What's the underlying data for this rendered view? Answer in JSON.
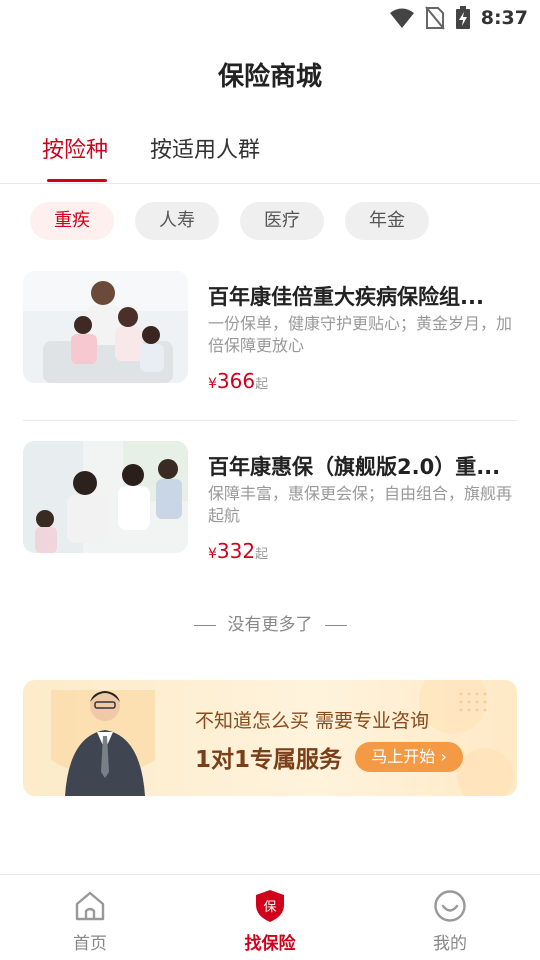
{
  "status_bar": {
    "time": "8:37"
  },
  "header": {
    "title": "保险商城"
  },
  "tabs": [
    {
      "label": "按险种"
    },
    {
      "label": "按适用人群"
    }
  ],
  "chips": [
    {
      "label": "重疾"
    },
    {
      "label": "人寿"
    },
    {
      "label": "医疗"
    },
    {
      "label": "年金"
    }
  ],
  "products": [
    {
      "title": "百年康佳倍重大疾病保险组...",
      "description": "一份保单，健康守护更贴心；黄金岁月，加倍保障更放心",
      "price_symbol": "¥",
      "price": "366",
      "price_suffix": "起"
    },
    {
      "title": "百年康惠保（旗舰版2.0）重...",
      "description": "保障丰富，惠保更会保；自由组合，旗舰再起航",
      "price_symbol": "¥",
      "price": "332",
      "price_suffix": "起"
    }
  ],
  "list_end": "没有更多了",
  "banner": {
    "line1": "不知道怎么买 需要专业咨询",
    "line2": "1对1专属服务",
    "button": "马上开始 ›"
  },
  "bottom_nav": [
    {
      "label": "首页",
      "icon": "home-icon"
    },
    {
      "label": "找保险",
      "icon": "shield-icon",
      "badge": "保"
    },
    {
      "label": "我的",
      "icon": "smile-icon"
    }
  ],
  "colors": {
    "accent": "#d0021b",
    "banner_button": "#f49a45"
  }
}
